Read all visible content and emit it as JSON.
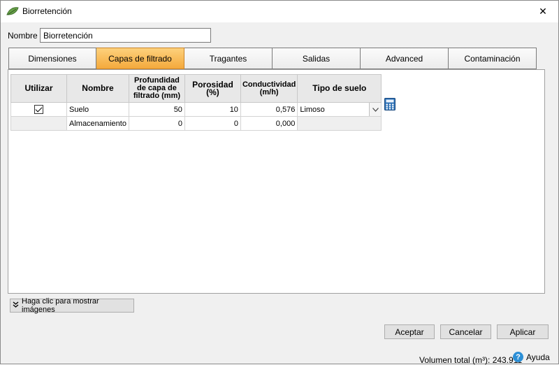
{
  "window": {
    "title": "Biorretención",
    "close_symbol": "✕"
  },
  "name_field": {
    "label": "Nombre",
    "value": "Biorretención"
  },
  "tabs": [
    {
      "label": "Dimensiones",
      "active": false
    },
    {
      "label": "Capas de filtrado",
      "active": true
    },
    {
      "label": "Tragantes",
      "active": false
    },
    {
      "label": "Salidas",
      "active": false
    },
    {
      "label": "Advanced",
      "active": false
    },
    {
      "label": "Contaminación",
      "active": false
    }
  ],
  "grid": {
    "headers": {
      "utilizar": "Utilizar",
      "nombre": "Nombre",
      "profundidad": "Profundidad de capa de filtrado (mm)",
      "porosidad": "Porosidad (%)",
      "conductividad": "Conductividad (m/h)",
      "tipo": "Tipo de suelo"
    },
    "rows": [
      {
        "utilizar": true,
        "nombre": "Suelo",
        "profundidad": "50",
        "porosidad": "10",
        "conductividad": "0,576",
        "tipo": "Limoso"
      },
      {
        "utilizar": null,
        "nombre": "Almacenamiento",
        "profundidad": "0",
        "porosidad": "0",
        "conductividad": "0,000",
        "tipo": ""
      }
    ]
  },
  "icons": {
    "calculator": "calculator-icon",
    "app": "leaf-app-icon",
    "help": "help-icon"
  },
  "images_button": {
    "label": "Haga clic para mostrar imágenes"
  },
  "actions": {
    "accept": "Aceptar",
    "cancel": "Cancelar",
    "apply": "Aplicar"
  },
  "status": {
    "volume_label": "Volumen total (m³): ",
    "volume_value": "243.911",
    "help_label": "Ayuda"
  },
  "colors": {
    "active_tab": "#f4a93c",
    "focus_border": "#d84040",
    "help_blue": "#2c8fd6"
  }
}
